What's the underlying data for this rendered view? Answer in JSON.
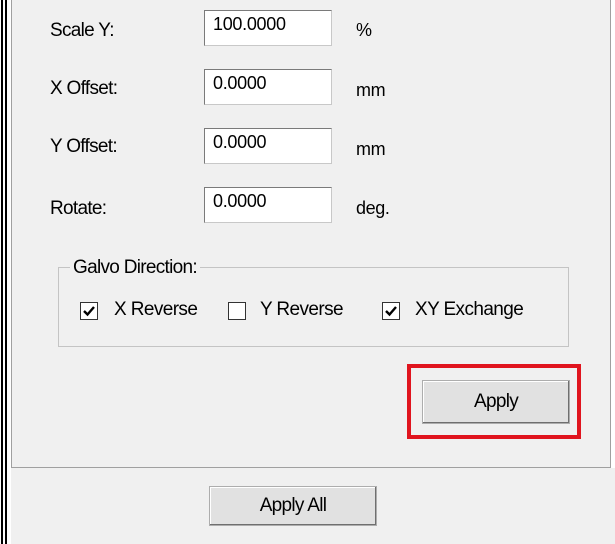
{
  "fields": [
    {
      "label": "Scale Y:",
      "value": "100.0000",
      "unit": "%"
    },
    {
      "label": "X Offset:",
      "value": "0.0000",
      "unit": "mm"
    },
    {
      "label": "Y Offset:",
      "value": "0.0000",
      "unit": "mm"
    },
    {
      "label": "Rotate:",
      "value": "0.0000",
      "unit": "deg."
    }
  ],
  "galvo": {
    "title": "Galvo Direction:",
    "options": [
      {
        "label": "X Reverse",
        "checked": true
      },
      {
        "label": "Y Reverse",
        "checked": false
      },
      {
        "label": "XY Exchange",
        "checked": true
      }
    ]
  },
  "buttons": {
    "apply": "Apply",
    "apply_all": "Apply All"
  },
  "colors": {
    "panel_bg": "#f0f0f0",
    "highlight": "#e0141e"
  }
}
